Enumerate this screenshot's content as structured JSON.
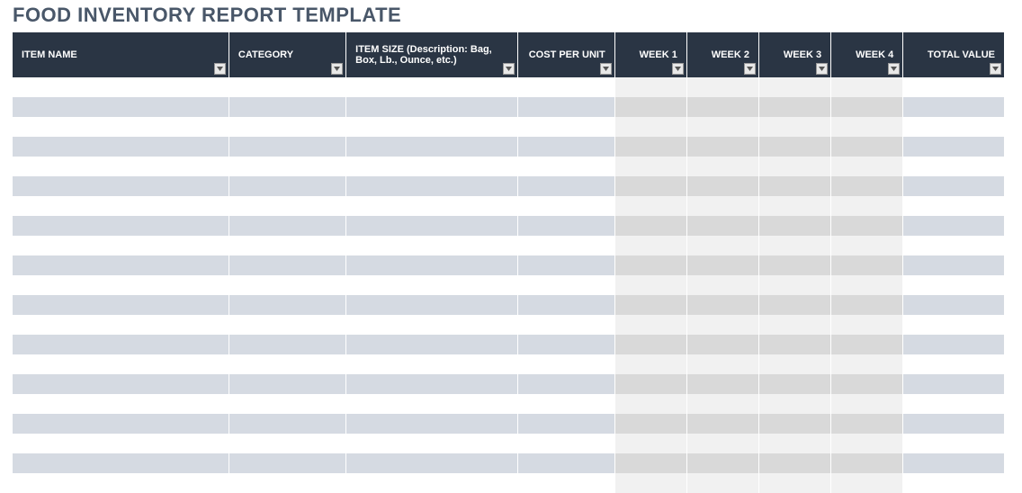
{
  "title": "FOOD INVENTORY REPORT TEMPLATE",
  "columns": [
    {
      "key": "item_name",
      "label": "ITEM NAME",
      "width_class": "col-itemname",
      "align": "left",
      "week": false
    },
    {
      "key": "category",
      "label": "CATEGORY",
      "width_class": "col-category",
      "align": "left",
      "week": false
    },
    {
      "key": "item_size",
      "label": "ITEM SIZE (Description: Bag, Box, Lb., Ounce, etc.)",
      "width_class": "col-itemsize",
      "align": "left",
      "week": false
    },
    {
      "key": "cost_per_unit",
      "label": "COST PER UNIT",
      "width_class": "col-cost",
      "align": "right",
      "week": false
    },
    {
      "key": "week1",
      "label": "WEEK 1",
      "width_class": "col-week",
      "align": "right",
      "week": true
    },
    {
      "key": "week2",
      "label": "WEEK 2",
      "width_class": "col-week",
      "align": "right",
      "week": true
    },
    {
      "key": "week3",
      "label": "WEEK 3",
      "width_class": "col-week",
      "align": "right",
      "week": true
    },
    {
      "key": "week4",
      "label": "WEEK 4",
      "width_class": "col-week",
      "align": "right",
      "week": true
    },
    {
      "key": "total_value",
      "label": "TOTAL VALUE",
      "width_class": "col-total",
      "align": "right",
      "week": false
    }
  ],
  "rows": [
    {
      "item_name": "",
      "category": "",
      "item_size": "",
      "cost_per_unit": "",
      "week1": "",
      "week2": "",
      "week3": "",
      "week4": "",
      "total_value": ""
    },
    {
      "item_name": "",
      "category": "",
      "item_size": "",
      "cost_per_unit": "",
      "week1": "",
      "week2": "",
      "week3": "",
      "week4": "",
      "total_value": ""
    },
    {
      "item_name": "",
      "category": "",
      "item_size": "",
      "cost_per_unit": "",
      "week1": "",
      "week2": "",
      "week3": "",
      "week4": "",
      "total_value": ""
    },
    {
      "item_name": "",
      "category": "",
      "item_size": "",
      "cost_per_unit": "",
      "week1": "",
      "week2": "",
      "week3": "",
      "week4": "",
      "total_value": ""
    },
    {
      "item_name": "",
      "category": "",
      "item_size": "",
      "cost_per_unit": "",
      "week1": "",
      "week2": "",
      "week3": "",
      "week4": "",
      "total_value": ""
    },
    {
      "item_name": "",
      "category": "",
      "item_size": "",
      "cost_per_unit": "",
      "week1": "",
      "week2": "",
      "week3": "",
      "week4": "",
      "total_value": ""
    },
    {
      "item_name": "",
      "category": "",
      "item_size": "",
      "cost_per_unit": "",
      "week1": "",
      "week2": "",
      "week3": "",
      "week4": "",
      "total_value": ""
    },
    {
      "item_name": "",
      "category": "",
      "item_size": "",
      "cost_per_unit": "",
      "week1": "",
      "week2": "",
      "week3": "",
      "week4": "",
      "total_value": ""
    },
    {
      "item_name": "",
      "category": "",
      "item_size": "",
      "cost_per_unit": "",
      "week1": "",
      "week2": "",
      "week3": "",
      "week4": "",
      "total_value": ""
    },
    {
      "item_name": "",
      "category": "",
      "item_size": "",
      "cost_per_unit": "",
      "week1": "",
      "week2": "",
      "week3": "",
      "week4": "",
      "total_value": ""
    },
    {
      "item_name": "",
      "category": "",
      "item_size": "",
      "cost_per_unit": "",
      "week1": "",
      "week2": "",
      "week3": "",
      "week4": "",
      "total_value": ""
    },
    {
      "item_name": "",
      "category": "",
      "item_size": "",
      "cost_per_unit": "",
      "week1": "",
      "week2": "",
      "week3": "",
      "week4": "",
      "total_value": ""
    },
    {
      "item_name": "",
      "category": "",
      "item_size": "",
      "cost_per_unit": "",
      "week1": "",
      "week2": "",
      "week3": "",
      "week4": "",
      "total_value": ""
    },
    {
      "item_name": "",
      "category": "",
      "item_size": "",
      "cost_per_unit": "",
      "week1": "",
      "week2": "",
      "week3": "",
      "week4": "",
      "total_value": ""
    },
    {
      "item_name": "",
      "category": "",
      "item_size": "",
      "cost_per_unit": "",
      "week1": "",
      "week2": "",
      "week3": "",
      "week4": "",
      "total_value": ""
    },
    {
      "item_name": "",
      "category": "",
      "item_size": "",
      "cost_per_unit": "",
      "week1": "",
      "week2": "",
      "week3": "",
      "week4": "",
      "total_value": ""
    },
    {
      "item_name": "",
      "category": "",
      "item_size": "",
      "cost_per_unit": "",
      "week1": "",
      "week2": "",
      "week3": "",
      "week4": "",
      "total_value": ""
    },
    {
      "item_name": "",
      "category": "",
      "item_size": "",
      "cost_per_unit": "",
      "week1": "",
      "week2": "",
      "week3": "",
      "week4": "",
      "total_value": ""
    },
    {
      "item_name": "",
      "category": "",
      "item_size": "",
      "cost_per_unit": "",
      "week1": "",
      "week2": "",
      "week3": "",
      "week4": "",
      "total_value": ""
    },
    {
      "item_name": "",
      "category": "",
      "item_size": "",
      "cost_per_unit": "",
      "week1": "",
      "week2": "",
      "week3": "",
      "week4": "",
      "total_value": ""
    },
    {
      "item_name": "",
      "category": "",
      "item_size": "",
      "cost_per_unit": "",
      "week1": "",
      "week2": "",
      "week3": "",
      "week4": "",
      "total_value": ""
    }
  ]
}
